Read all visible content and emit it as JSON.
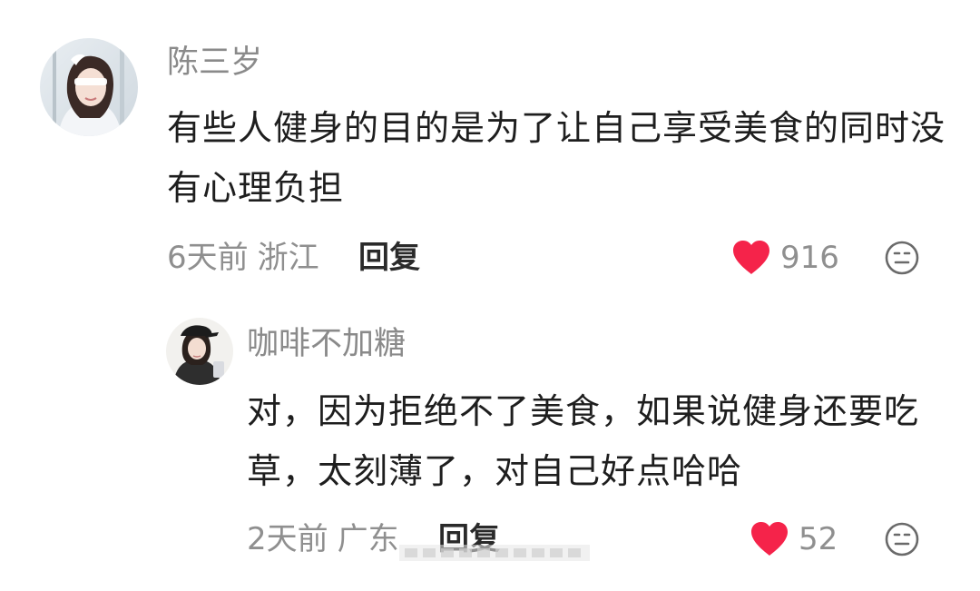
{
  "comments": [
    {
      "username": "陈三岁",
      "text": "有些人健身的目的是为了让自己享受美食的同时没有心理负担",
      "time": "6天前",
      "location": "浙江",
      "reply_label": "回复",
      "likes": "916",
      "avatar_icon": "avatar-girl-white-dress",
      "heart_icon": "heart-icon",
      "emoji_icon": "neutral-face-icon"
    },
    {
      "username": "咖啡不加糖",
      "text": "对，因为拒绝不了美食，如果说健身还要吃草，太刻薄了，对自己好点哈哈",
      "time": "2天前",
      "location": "广东",
      "reply_label": "回复",
      "likes": "52",
      "avatar_icon": "avatar-girl-black-cap",
      "heart_icon": "heart-icon",
      "emoji_icon": "neutral-face-icon"
    }
  ],
  "colors": {
    "heart": "#f5234a",
    "username": "#8a8a8a",
    "text": "#1e1e1e",
    "meta": "#8f8f8f"
  }
}
